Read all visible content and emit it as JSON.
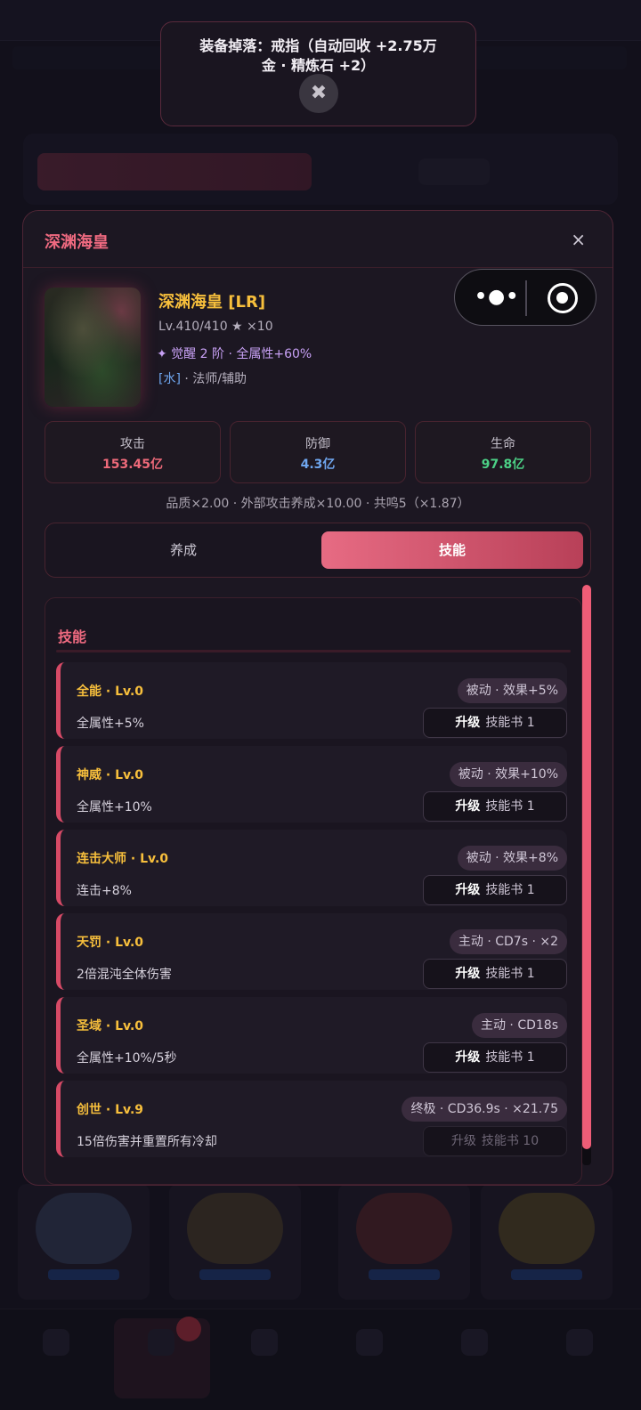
{
  "toast": {
    "line1": "装备掉落：戒指（自动回收 +2.75万",
    "line2": "金 · 精炼石 +2）",
    "close_icon": "✖"
  },
  "modal": {
    "title": "深渊海皇",
    "close_icon": "×"
  },
  "capsule": {
    "more_icon": "•●•",
    "target_icon": "target-icon"
  },
  "hero": {
    "name": "深渊海皇 [LR]",
    "level": "Lv.410/410 ★ ×10",
    "awaken": "✦ 觉醒 2 阶 · 全属性+60%",
    "element": "[水]",
    "role": " · 法师/辅助"
  },
  "stats": [
    {
      "label": "攻击",
      "value": "153.45亿",
      "color": "#ef6a7a"
    },
    {
      "label": "防御",
      "value": "4.3亿",
      "color": "#6fa6ef"
    },
    {
      "label": "生命",
      "value": "97.8亿",
      "color": "#4cd186"
    }
  ],
  "quality_line": "品质×2.00 · 外部攻击养成×10.00 · 共鸣5（×1.87）",
  "tabs": {
    "train": "养成",
    "skills": "技能"
  },
  "skills_title": "技能",
  "upgrade_label": "升级",
  "skills": [
    {
      "name": "全能 · Lv.0",
      "desc": "全属性+5%",
      "tag": "被动 · 效果+5%",
      "book": "技能书 1"
    },
    {
      "name": "神威 · Lv.0",
      "desc": "全属性+10%",
      "tag": "被动 · 效果+10%",
      "book": "技能书 1"
    },
    {
      "name": "连击大师 · Lv.0",
      "desc": "连击+8%",
      "tag": "被动 · 效果+8%",
      "book": "技能书 1"
    },
    {
      "name": "天罚 · Lv.0",
      "desc": "2倍混沌全体伤害",
      "tag": "主动 · CD7s · ×2",
      "book": "技能书 1"
    },
    {
      "name": "圣域 · Lv.0",
      "desc": "全属性+10%/5秒",
      "tag": "主动 · CD18s",
      "book": "技能书 1"
    },
    {
      "name": "创世 · Lv.9",
      "desc": "15倍伤害并重置所有冷却",
      "tag": "终极 · CD36.9s · ×21.75",
      "book": "技能书 10"
    }
  ]
}
